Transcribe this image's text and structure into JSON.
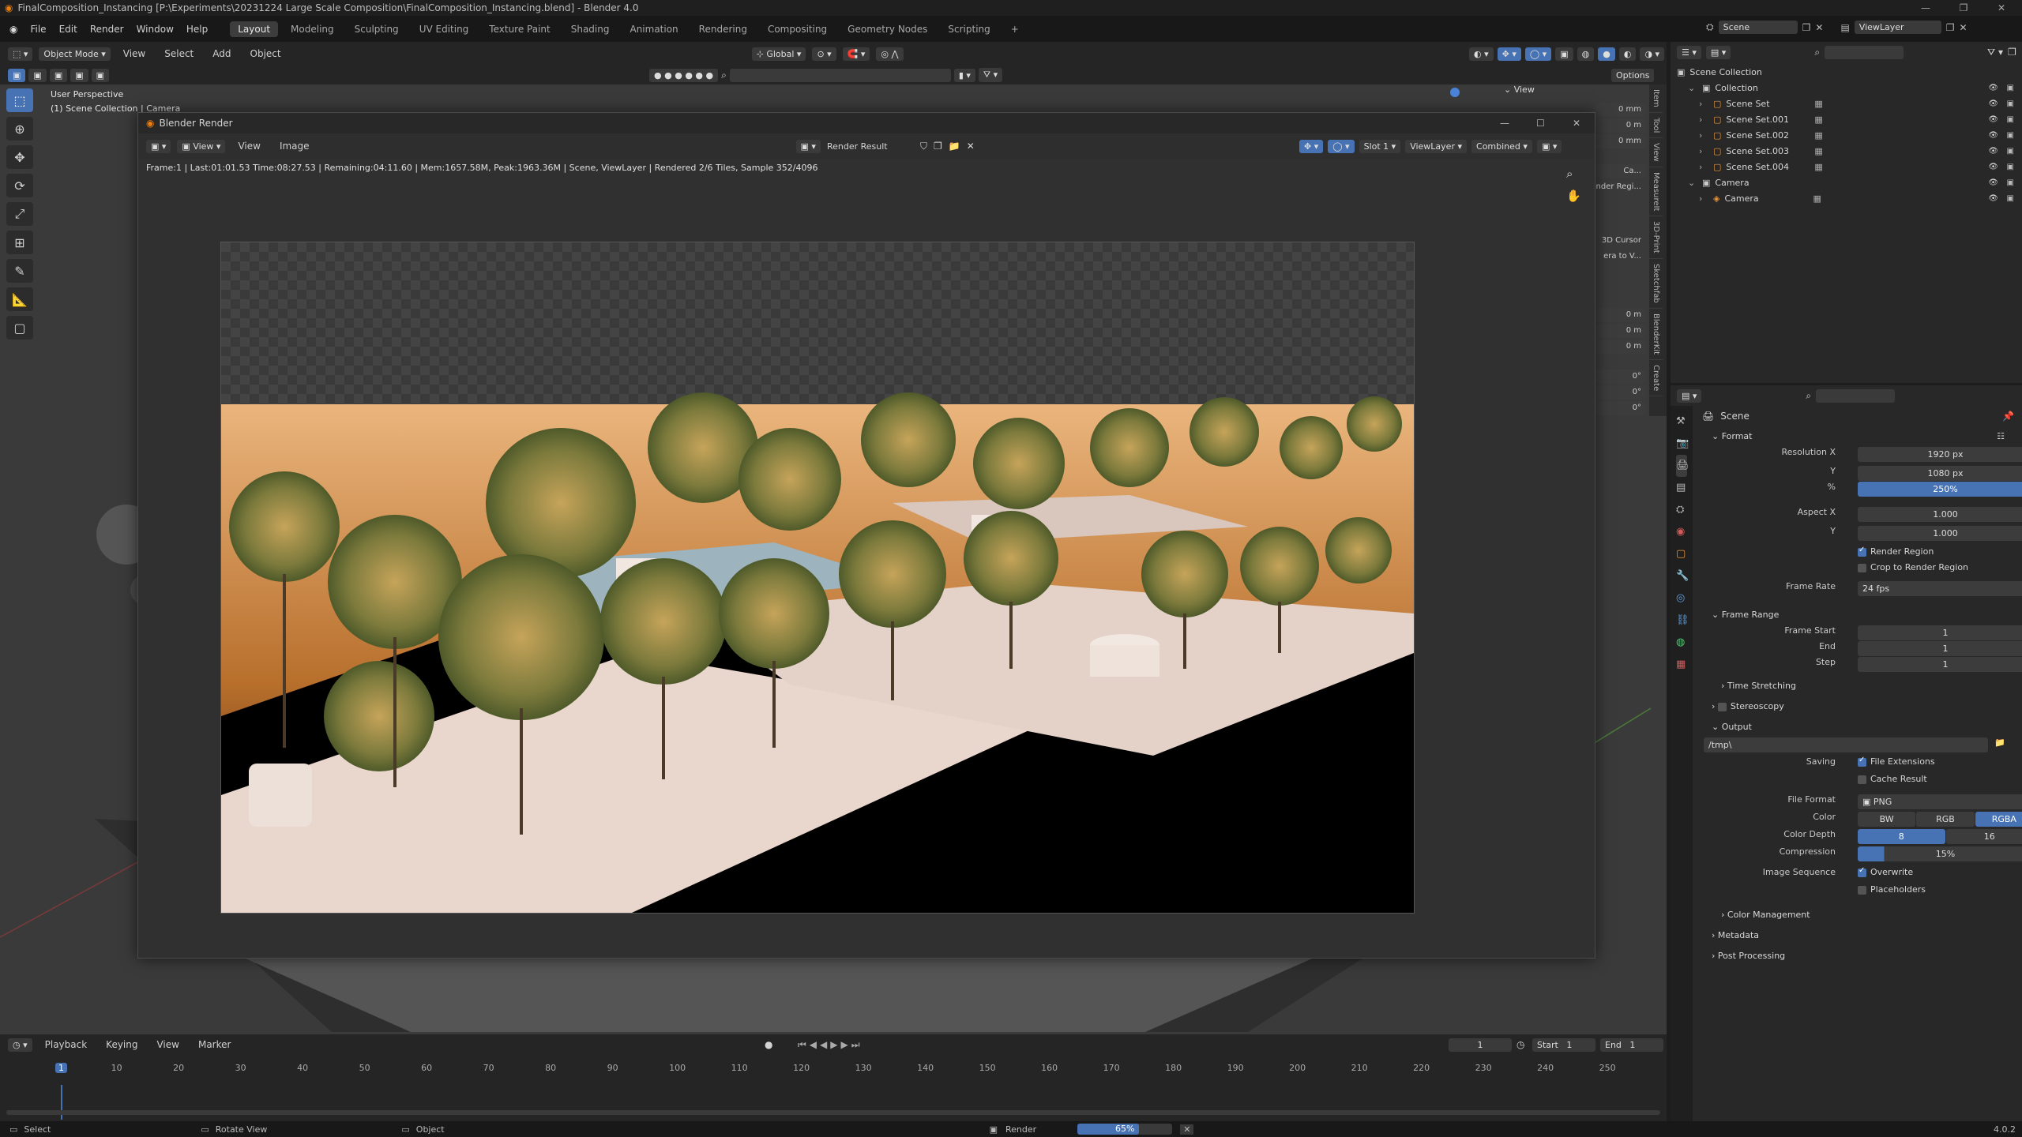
{
  "titlebar": {
    "title": "FinalComposition_Instancing [P:\\Experiments\\20231224 Large Scale Composition\\FinalComposition_Instancing.blend] - Blender 4.0"
  },
  "menu": [
    "File",
    "Edit",
    "Render",
    "Window",
    "Help"
  ],
  "workspaces": [
    "Layout",
    "Modeling",
    "Sculpting",
    "UV Editing",
    "Texture Paint",
    "Shading",
    "Animation",
    "Rendering",
    "Compositing",
    "Geometry Nodes",
    "Scripting"
  ],
  "active_workspace": "Layout",
  "scene_selector": "Scene",
  "viewlayer_selector": "ViewLayer",
  "viewport_header": {
    "mode": "Object Mode",
    "menus": [
      "View",
      "Select",
      "Add",
      "Object"
    ],
    "orientation": "Global",
    "options": "Options"
  },
  "viewport": {
    "perspective": "User Perspective",
    "collection": "(1) Scene Collection | Camera",
    "view_toggle": "View"
  },
  "npanel_tabs": [
    "Item",
    "Tool",
    "View",
    "MeasureIt",
    "3D-Print",
    "Sketchfab",
    "BlenderKit",
    "Create"
  ],
  "npanel_values": [
    "0 mm",
    "0 m",
    "0 mm",
    "Ca...",
    "nder Regi...",
    "3D Cursor",
    "era to V...",
    "0 m",
    "0 m",
    "0 m",
    "0°",
    "0°",
    "0°"
  ],
  "render_window": {
    "title": "Blender Render",
    "menus": [
      "View",
      "Image"
    ],
    "image_name": "Render Result",
    "slot": "Slot 1",
    "layer": "ViewLayer",
    "pass": "Combined",
    "stats": "Frame:1 | Last:01:01.53 Time:08:27.53 | Remaining:04:11.60 | Mem:1657.58M, Peak:1963.36M | Scene, ViewLayer | Rendered 2/6 Tiles, Sample 352/4096",
    "progress": 0.33
  },
  "outliner": {
    "root": "Scene Collection",
    "items": [
      {
        "label": "Collection",
        "depth": 1
      },
      {
        "label": "Scene Set",
        "depth": 2
      },
      {
        "label": "Scene Set.001",
        "depth": 2
      },
      {
        "label": "Scene Set.002",
        "depth": 2
      },
      {
        "label": "Scene Set.003",
        "depth": 2
      },
      {
        "label": "Scene Set.004",
        "depth": 2
      },
      {
        "label": "Camera",
        "depth": 1
      },
      {
        "label": "Camera",
        "depth": 2
      }
    ]
  },
  "properties": {
    "context": "Scene",
    "format": {
      "header": "Format",
      "res_x_label": "Resolution X",
      "res_x": "1920 px",
      "res_y_label": "Y",
      "res_y": "1080 px",
      "pct_label": "%",
      "pct": "250%",
      "aspect_x_label": "Aspect X",
      "aspect_x": "1.000",
      "aspect_y_label": "Y",
      "aspect_y": "1.000",
      "render_region": "Render Region",
      "crop": "Crop to Render Region",
      "frame_rate_label": "Frame Rate",
      "frame_rate": "24 fps"
    },
    "frame_range": {
      "header": "Frame Range",
      "start_label": "Frame Start",
      "start": "1",
      "end_label": "End",
      "end": "1",
      "step_label": "Step",
      "step": "1"
    },
    "time_stretching": "Time Stretching",
    "stereoscopy": "Stereoscopy",
    "output": {
      "header": "Output",
      "path": "/tmp\\",
      "saving_label": "Saving",
      "file_extensions": "File Extensions",
      "cache_result": "Cache Result",
      "file_format_label": "File Format",
      "file_format": "PNG",
      "color_label": "Color",
      "color_options": [
        "BW",
        "RGB",
        "RGBA"
      ],
      "color_active": "RGBA",
      "depth_label": "Color Depth",
      "depth_options": [
        "8",
        "16"
      ],
      "depth_active": "8",
      "compression_label": "Compression",
      "compression": "15%",
      "image_seq_label": "Image Sequence",
      "overwrite": "Overwrite",
      "placeholders": "Placeholders"
    },
    "color_management": "Color Management",
    "metadata": "Metadata",
    "post_processing": "Post Processing"
  },
  "timeline": {
    "menus": [
      "Playback",
      "Keying",
      "View",
      "Marker"
    ],
    "current_frame": "1",
    "start_label": "Start",
    "start": "1",
    "end_label": "End",
    "end": "1",
    "ticks": [
      "1",
      "10",
      "20",
      "30",
      "40",
      "50",
      "60",
      "70",
      "80",
      "90",
      "100",
      "110",
      "120",
      "130",
      "140",
      "150",
      "160",
      "170",
      "180",
      "190",
      "200",
      "210",
      "220",
      "230",
      "240",
      "250"
    ]
  },
  "status": {
    "select": "Select",
    "rotate": "Rotate View",
    "object": "Object",
    "render_label": "Render",
    "render_progress": "65%",
    "version": "4.0.2"
  },
  "colors": {
    "accent": "#4772b3",
    "sky_top": "#e8b27a",
    "sky_bottom": "#8a4a0a",
    "ground": "#e9d6cc"
  }
}
